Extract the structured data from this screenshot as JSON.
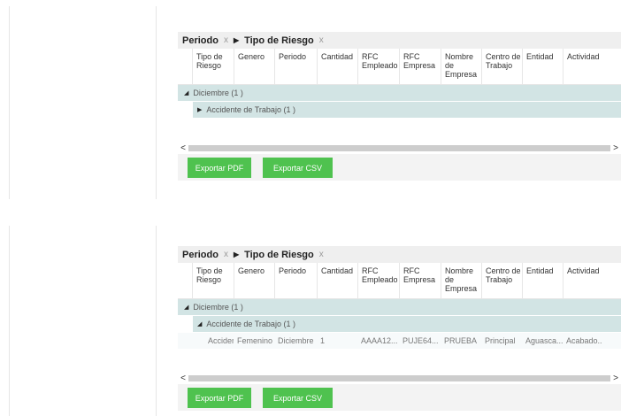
{
  "group_chips": [
    {
      "label": "Periodo",
      "remove": "x"
    },
    {
      "label": "Tipo de Riesgo",
      "remove": "x"
    }
  ],
  "columns": [
    [
      "Tipo de",
      "Riesgo"
    ],
    [
      "Genero"
    ],
    [
      "Periodo"
    ],
    [
      "Cantidad"
    ],
    [
      "RFC",
      "Empleado"
    ],
    [
      "RFC",
      "Empresa"
    ],
    [
      "Nombre",
      "de",
      "Empresa"
    ],
    [
      "Centro de",
      "Trabajo"
    ],
    [
      "Entidad"
    ],
    [
      "Actividad"
    ]
  ],
  "grid1": {
    "group_level1": "Diciembre (1 )",
    "group_level2": "Accidente de Trabajo (1 )"
  },
  "grid2": {
    "group_level1": "Diciembre (1 )",
    "group_level2": "Accidente de Trabajo (1 )",
    "row": [
      "Accident...",
      "Femenino",
      "Diciembre",
      "1",
      "AAAA12...",
      "PUJE64...",
      "PRUEBA",
      "Principal",
      "Aguasca...",
      "Acabado..."
    ]
  },
  "buttons": {
    "export_pdf": "Exportar PDF",
    "export_csv": "Exportar CSV"
  },
  "scroll_arrows": {
    "left": "<",
    "right": ">"
  },
  "icons": {
    "group_separator": "arrow-right-icon",
    "expanded": "triangle-down-icon",
    "collapsed": "triangle-right-icon"
  },
  "colors": {
    "group_row": "#d2e4e4",
    "button": "#4fc24f",
    "groupbar": "#efefef"
  }
}
